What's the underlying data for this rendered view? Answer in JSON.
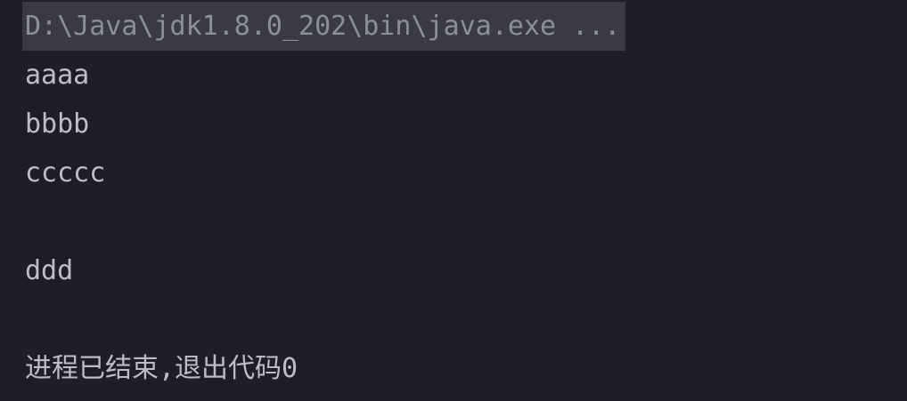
{
  "console": {
    "command_line": "D:\\Java\\jdk1.8.0_202\\bin\\java.exe ...",
    "output_lines": [
      "aaaa",
      "bbbb",
      "ccccc",
      "",
      "ddd",
      "",
      "进程已结束,退出代码0"
    ]
  }
}
